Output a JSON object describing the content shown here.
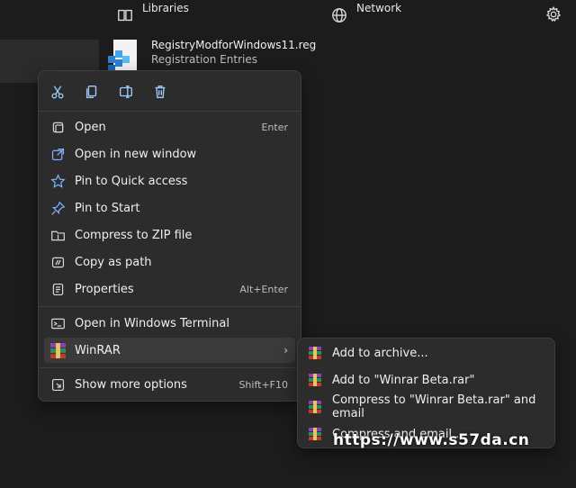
{
  "topbar": {
    "libraries_label": "Libraries",
    "network_label": "Network"
  },
  "file": {
    "name": "RegistryModforWindows11.reg",
    "type": "Registration Entries"
  },
  "context_menu": {
    "toolbar": [
      "cut-icon",
      "copy-icon",
      "rename-icon",
      "delete-icon"
    ],
    "items": [
      {
        "label": "Open",
        "shortcut": "Enter",
        "icon": "open-icon"
      },
      {
        "label": "Open in new window",
        "shortcut": "",
        "icon": "new-window-icon"
      },
      {
        "label": "Pin to Quick access",
        "shortcut": "",
        "icon": "star-icon"
      },
      {
        "label": "Pin to Start",
        "shortcut": "",
        "icon": "pin-icon"
      },
      {
        "label": "Compress to ZIP file",
        "shortcut": "",
        "icon": "zip-icon"
      },
      {
        "label": "Copy as path",
        "shortcut": "",
        "icon": "copy-path-icon"
      },
      {
        "label": "Properties",
        "shortcut": "Alt+Enter",
        "icon": "properties-icon"
      }
    ],
    "terminal": {
      "label": "Open in Windows Terminal",
      "icon": "terminal-icon"
    },
    "winrar": {
      "label": "WinRAR",
      "chevron": "›",
      "icon": "winrar-icon"
    },
    "more": {
      "label": "Show more options",
      "shortcut": "Shift+F10",
      "icon": "more-options-icon"
    }
  },
  "winrar_submenu": {
    "items": [
      {
        "label": "Add to archive..."
      },
      {
        "label": "Add to \"Winrar Beta.rar\""
      },
      {
        "label": "Compress to \"Winrar Beta.rar\" and email"
      },
      {
        "label": "Compress and email..."
      }
    ]
  },
  "watermark": "https://www.s57da.cn",
  "colors": {
    "background": "#1c1c1c",
    "menu_bg": "#2c2c2c",
    "accent": "#7fb6ff"
  }
}
